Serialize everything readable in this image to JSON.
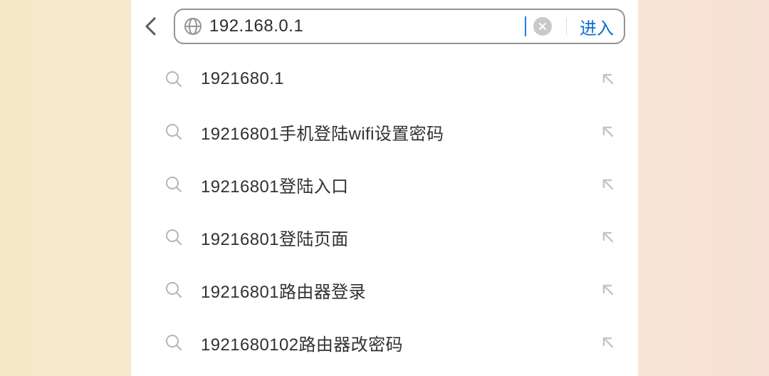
{
  "urlbar": {
    "value": "192.168.0.1",
    "enter_label": "进入"
  },
  "suggestions": [
    {
      "text": "1921680.1"
    },
    {
      "text": "19216801手机登陆wifi设置密码"
    },
    {
      "text": "19216801登陆入口"
    },
    {
      "text": "19216801登陆页面"
    },
    {
      "text": "19216801路由器登录"
    },
    {
      "text": "1921680102路由器改密码"
    }
  ]
}
